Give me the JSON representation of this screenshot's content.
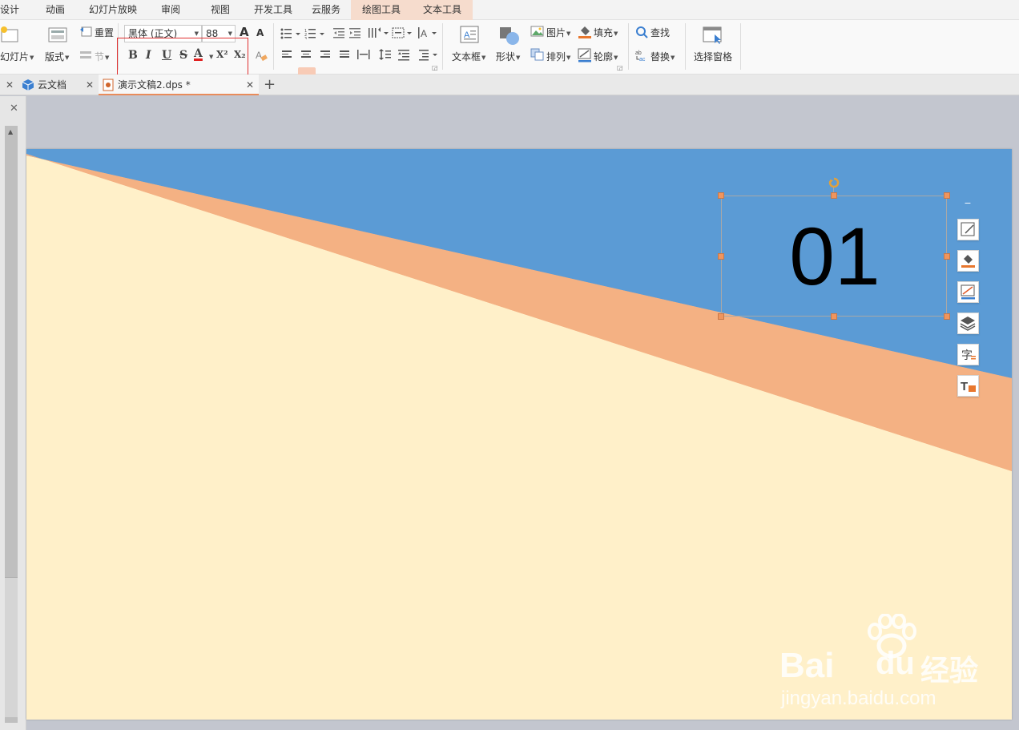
{
  "menubar": {
    "tabs": [
      "设计",
      "动画",
      "幻灯片放映",
      "审阅",
      "视图",
      "开发工具",
      "云服务",
      "绘图工具",
      "文本工具"
    ]
  },
  "ribbon": {
    "new_slide": "幻灯片",
    "layout": "版式",
    "reset": "重置",
    "section": "节",
    "font_name": "黑体 (正文)",
    "font_size": "88",
    "grow_font": "A",
    "shrink_font": "A",
    "bold": "B",
    "italic": "I",
    "underline": "U",
    "strike": "S",
    "font_color": "A",
    "superscript": "X²",
    "subscript": "X₂",
    "textbox": "文本框",
    "shape": "形状",
    "picture": "图片",
    "arrange": "排列",
    "fill": "填充",
    "outline": "轮廓",
    "find": "查找",
    "replace": "替换",
    "select_pane": "选择窗格"
  },
  "doctabs": {
    "cloud_docs": "云文档",
    "active_doc": "演示文稿2.dps *"
  },
  "slide": {
    "number_text": "01",
    "colors": {
      "blue": "#5b9bd5",
      "orange": "#f4b183",
      "cream": "#fff0c9"
    }
  },
  "side_toolbar": [
    "shape-style-icon",
    "fill-bucket-icon",
    "outline-icon",
    "layers-icon",
    "text-style-icon",
    "text-box-convert-icon"
  ],
  "watermark": {
    "brand": "Bai",
    "brand2": "du",
    "brand3": "经验",
    "url": "jingyan.baidu.com"
  }
}
